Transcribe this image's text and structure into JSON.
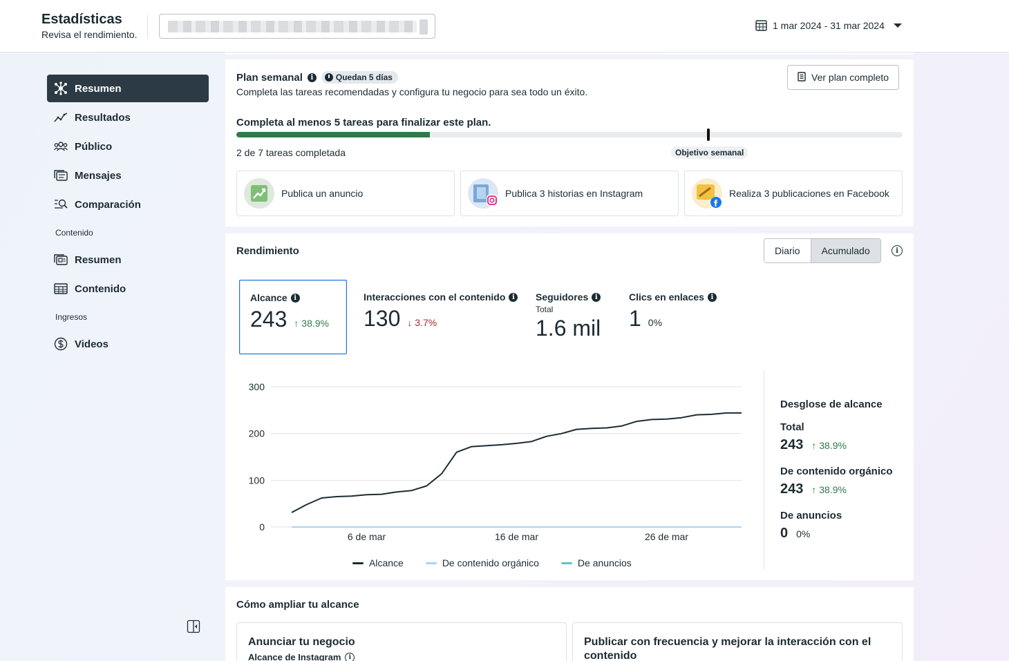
{
  "header": {
    "title": "Estadísticas",
    "subtitle": "Revisa el rendimiento.",
    "date_range": "1 mar 2024 - 31 mar 2024"
  },
  "sidebar": {
    "items": [
      {
        "label": "Resumen",
        "icon": "hub-icon",
        "active": true
      },
      {
        "label": "Resultados",
        "icon": "trend-icon"
      },
      {
        "label": "Público",
        "icon": "people-icon"
      },
      {
        "label": "Mensajes",
        "icon": "messages-icon"
      },
      {
        "label": "Comparación",
        "icon": "compare-icon"
      }
    ],
    "content_section": "Contenido",
    "content_items": [
      {
        "label": "Resumen",
        "icon": "content-summary-icon"
      },
      {
        "label": "Contenido",
        "icon": "table-icon"
      }
    ],
    "income_section": "Ingresos",
    "income_items": [
      {
        "label": "Videos",
        "icon": "dollar-icon"
      }
    ]
  },
  "plan": {
    "title": "Plan semanal",
    "days_left": "Quedan 5 días",
    "description": "Completa las tareas recomendadas y configura tu negocio para sea todo un éxito.",
    "view_button": "Ver plan completo",
    "goal": "Completa al menos 5 tareas para finalizar este plan.",
    "progress": 0.29,
    "progress_text": "2 de 7 tareas completada",
    "goal_label": "Objetivo semanal",
    "tasks": [
      {
        "label": "Publica un anuncio"
      },
      {
        "label": "Publica 3 historias en Instagram"
      },
      {
        "label": "Realiza 3 publicaciones en Facebook"
      }
    ]
  },
  "performance": {
    "title": "Rendimiento",
    "toggle": [
      "Diario",
      "Acumulado"
    ],
    "metrics": [
      {
        "label": "Alcance",
        "value": "243",
        "change": "38.9%",
        "direction": "up"
      },
      {
        "label": "Interacciones con el contenido",
        "value": "130",
        "change": "3.7%",
        "direction": "down"
      },
      {
        "label": "Seguidores",
        "sub": "Total",
        "value": "1.6 mil"
      },
      {
        "label": "Clics en enlaces",
        "value": "1",
        "change": "0%"
      }
    ],
    "breakdown": {
      "title": "Desglose de alcance",
      "rows": [
        {
          "label": "Total",
          "value": "243",
          "change": "38.9%",
          "direction": "up"
        },
        {
          "label": "De contenido orgánico",
          "value": "243",
          "change": "38.9%",
          "direction": "up"
        },
        {
          "label": "De anuncios",
          "value": "0",
          "change": "0%",
          "direction": "neutral"
        }
      ]
    }
  },
  "chart_data": {
    "type": "line",
    "x": [
      1,
      2,
      3,
      4,
      5,
      6,
      7,
      8,
      9,
      10,
      11,
      12,
      13,
      14,
      15,
      16,
      17,
      18,
      19,
      20,
      21,
      22,
      23,
      24,
      25,
      26,
      27,
      28,
      29,
      30,
      31
    ],
    "x_ticks": [
      {
        "x": 6,
        "label": "6 de mar"
      },
      {
        "x": 16,
        "label": "16 de mar"
      },
      {
        "x": 26,
        "label": "26 de mar"
      }
    ],
    "ylim": [
      0,
      300
    ],
    "y_ticks": [
      0,
      100,
      200,
      300
    ],
    "grid": true,
    "series": [
      {
        "name": "Alcance",
        "color": "#1c2b33",
        "values": [
          31,
          48,
          62,
          65,
          66,
          69,
          70,
          75,
          78,
          88,
          114,
          160,
          172,
          174,
          176,
          179,
          183,
          194,
          200,
          209,
          211,
          212,
          216,
          226,
          230,
          231,
          234,
          240,
          241,
          244,
          244
        ]
      },
      {
        "name": "De contenido orgánico",
        "color": "#a9d4f2",
        "values": [
          0,
          0,
          0,
          0,
          0,
          0,
          0,
          0,
          0,
          0,
          0,
          0,
          0,
          0,
          0,
          0,
          0,
          0,
          0,
          0,
          0,
          0,
          0,
          0,
          0,
          0,
          0,
          0,
          0,
          0,
          0
        ]
      },
      {
        "name": "De anuncios",
        "color": "#5cc4c8",
        "values": [
          0,
          0,
          0,
          0,
          0,
          0,
          0,
          0,
          0,
          0,
          0,
          0,
          0,
          0,
          0,
          0,
          0,
          0,
          0,
          0,
          0,
          0,
          0,
          0,
          0,
          0,
          0,
          0,
          0,
          0,
          0
        ]
      }
    ]
  },
  "reach": {
    "title": "Cómo ampliar tu alcance",
    "cards": [
      {
        "title": "Anunciar tu negocio",
        "meta": "Alcance de Instagram"
      },
      {
        "title": "Publicar con frecuencia y mejorar la interacción con el contenido"
      }
    ]
  }
}
